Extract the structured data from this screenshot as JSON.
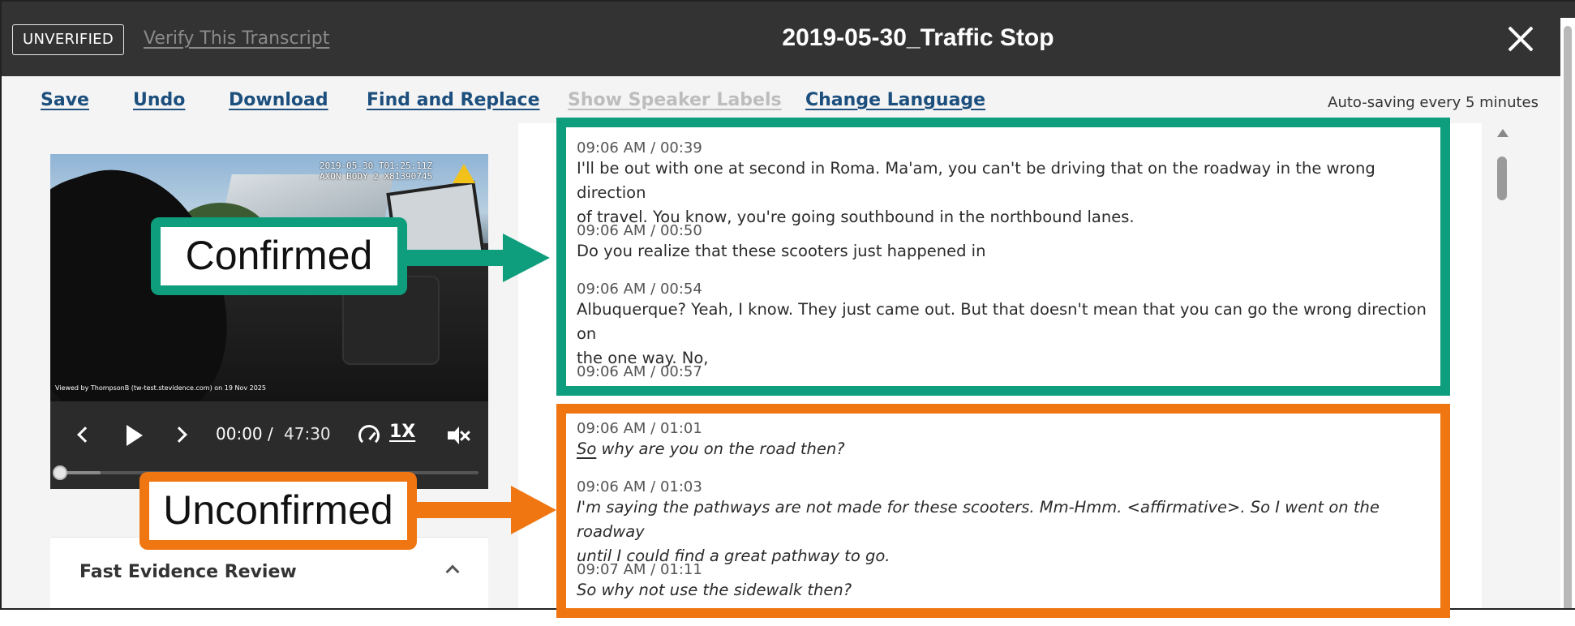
{
  "header": {
    "badge": "UNVERIFIED",
    "verify_link": "Verify This Transcript",
    "title": "2019-05-30_Traffic Stop"
  },
  "toolbar": {
    "save": "Save",
    "undo": "Undo",
    "download": "Download",
    "find_replace": "Find and Replace",
    "speaker_labels": "Show Speaker Labels",
    "change_language": "Change Language",
    "autosave": "Auto-saving every 5 minutes"
  },
  "video": {
    "timestamp_overlay": "2019-05-30 T01:25:11Z\nAXON BODY 2 X81390745",
    "watermark": "Viewed by ThompsonB (tw-test.stevidence.com) on 19 Nov 2025"
  },
  "player": {
    "current_time": "00:00",
    "separator": "/",
    "total_time": "47:30",
    "speed": "1X",
    "progress_fraction": 0.0
  },
  "fast_evidence_review": {
    "title": "Fast Evidence Review"
  },
  "transcript": {
    "confirmed": [
      {
        "timestamp": "09:06 AM / 00:39",
        "lines": [
          "I'll be out with one at second in Roma. Ma'am, you can't be driving that on the roadway in the wrong direction",
          "of travel. You know, you're going southbound in the northbound lanes."
        ]
      },
      {
        "timestamp": "09:06 AM / 00:50",
        "lines": [
          "Do you realize that these scooters just happened in"
        ]
      },
      {
        "timestamp": "09:06 AM / 00:54",
        "lines": [
          "Albuquerque? Yeah, I know. They just came out. But that doesn't mean that you can go the wrong direction on",
          "the one way. No,"
        ]
      },
      {
        "timestamp": "09:06 AM / 00:57",
        "lines": []
      }
    ],
    "unconfirmed": [
      {
        "timestamp": "09:06 AM / 01:01",
        "first_word": "So",
        "rest": " why are you on the road then?"
      },
      {
        "timestamp": "09:06 AM / 01:03",
        "lines": [
          "I'm saying the pathways are not made for these scooters. Mm-Hmm. <affirmative>. So I went on the roadway",
          "until I could find a great pathway to go."
        ]
      },
      {
        "timestamp": "09:07 AM / 01:11",
        "lines": [
          "So why not use the sidewalk then?"
        ]
      }
    ]
  },
  "annotations": {
    "confirmed_label": "Confirmed",
    "unconfirmed_label": "Unconfirmed",
    "confirmed_color": "#0e9e7d",
    "unconfirmed_color": "#f07611"
  },
  "colors": {
    "titlebar": "#333333",
    "link": "#1c4f7d",
    "disabled": "#bdbdbd"
  }
}
